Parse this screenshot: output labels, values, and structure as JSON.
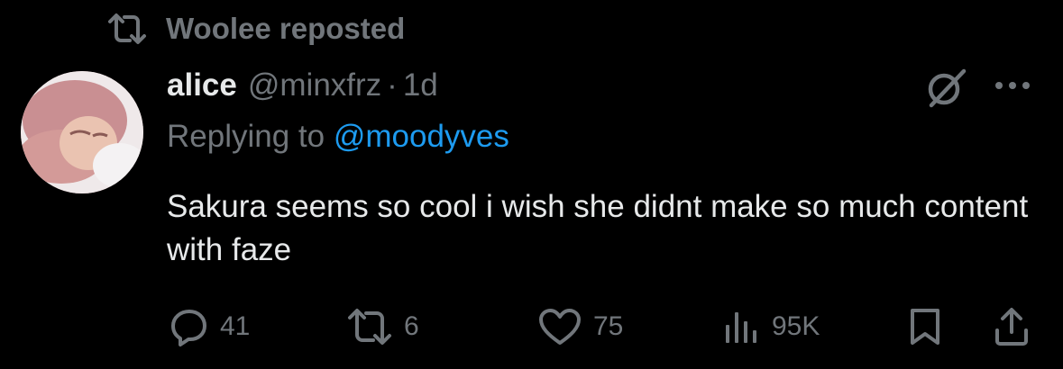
{
  "repost_banner": {
    "icon": "repost-icon",
    "text": "Woolee reposted"
  },
  "tweet": {
    "avatar_icon": "avatar-photo",
    "display_name": "alice",
    "handle": "@minxfrz",
    "separator": "·",
    "time": "1d",
    "replying_prefix": "Replying to",
    "replying_to": "@moodyves",
    "text": "Sakura seems so cool i wish she didnt make so much content with faze"
  },
  "actions": {
    "replies": "41",
    "reposts": "6",
    "likes": "75",
    "views": "95K"
  },
  "colors": {
    "background": "#000000",
    "primary_text": "#e7e9ea",
    "secondary_text": "#71767b",
    "link": "#1d9bf0"
  }
}
